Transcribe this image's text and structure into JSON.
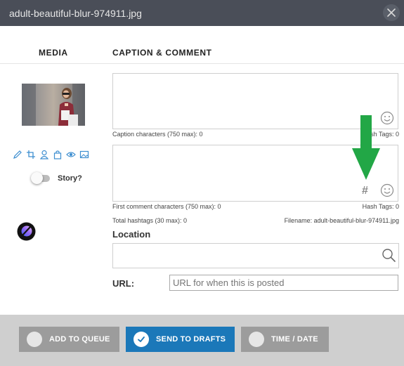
{
  "window": {
    "title": "adult-beautiful-blur-974911.jpg"
  },
  "headers": {
    "media": "MEDIA",
    "caption_comment": "CAPTION & COMMENT"
  },
  "media": {
    "tools": [
      "pencil-icon",
      "crop-icon",
      "person-tag-icon",
      "bag-icon",
      "eye-icon",
      "image-icon"
    ],
    "story_label": "Story?",
    "story_enabled": false
  },
  "caption": {
    "value": "",
    "count_label": "Caption characters (750 max): 0",
    "hashtags_label": "Hash Tags: 0"
  },
  "comment": {
    "value": "",
    "count_label": "First comment characters (750 max): 0",
    "hashtags_label": "Hash Tags: 0",
    "hash_symbol": "#"
  },
  "totals": {
    "total_hashtags": "Total hashtags (30 max): 0",
    "filename": "Filename: adult-beautiful-blur-974911.jpg"
  },
  "location": {
    "label": "Location",
    "value": "",
    "placeholder": ""
  },
  "url": {
    "label": "URL:",
    "value": "",
    "placeholder": "URL for when this is posted"
  },
  "footer": {
    "add_to_queue": "ADD TO QUEUE",
    "send_to_drafts": "SEND TO DRAFTS",
    "time_date": "TIME / DATE"
  },
  "colors": {
    "titlebar": "#4a4e58",
    "primary_button": "#1b78b9",
    "secondary_button": "#9c9c9c",
    "footer_bg": "#cfcfcf",
    "arrow": "#22a746"
  }
}
